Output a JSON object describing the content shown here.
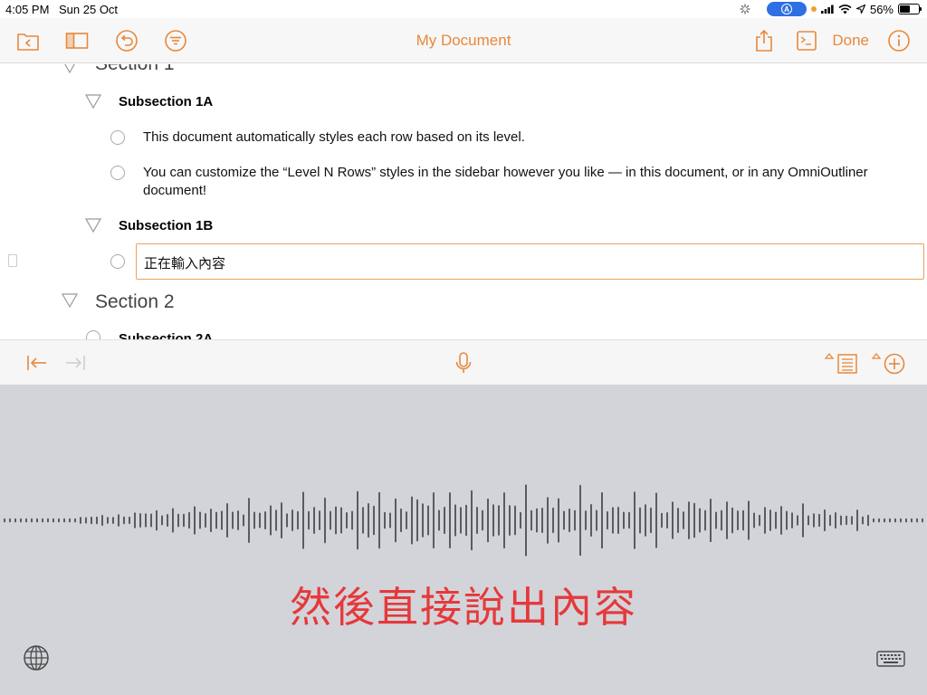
{
  "status": {
    "time": "4:05 PM",
    "date": "Sun 25 Oct",
    "battery": "56%",
    "battery_level": 0.56
  },
  "toolbar": {
    "title": "My Document",
    "done_label": "Done"
  },
  "outline": {
    "section1": "Section 1",
    "subsection1a": "Subsection 1A",
    "row1": "This document automatically styles each row based on its level.",
    "row2_line1": "You can customize the “Level N Rows” styles in the sidebar however you like — in this document, or in any OmniOutliner",
    "row2_line2": "document!",
    "subsection1b": "Subsection 1B",
    "editing_text": "正在輸入內容",
    "section2": "Section 2",
    "subsection2a": "Subsection 2A"
  },
  "dictation": {
    "text": "然後直接說出內容"
  },
  "colors": {
    "accent": "#e8883a",
    "dictation_text": "#e5393b",
    "dictation_bg": "#d3d4d9"
  }
}
